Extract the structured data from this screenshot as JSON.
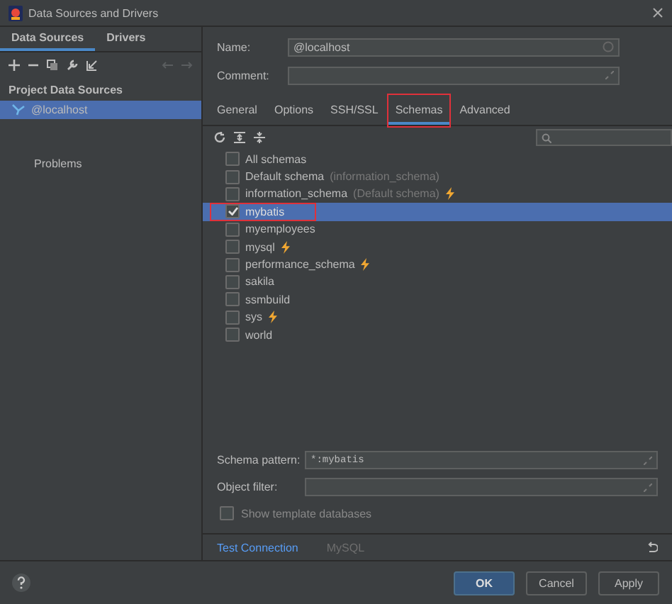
{
  "window": {
    "title": "Data Sources and Drivers"
  },
  "sidebar": {
    "tabs": [
      {
        "label": "Data Sources",
        "selected": true
      },
      {
        "label": "Drivers",
        "selected": false
      }
    ],
    "section": "Project Data Sources",
    "items": [
      {
        "label": "@localhost",
        "selected": true
      }
    ],
    "problems": "Problems"
  },
  "form": {
    "name": {
      "label": "Name:",
      "value": "@localhost"
    },
    "comment": {
      "label": "Comment:"
    }
  },
  "tabs": [
    {
      "label": "General",
      "selected": false,
      "marked": false
    },
    {
      "label": "Options",
      "selected": false,
      "marked": false
    },
    {
      "label": "SSH/SSL",
      "selected": false,
      "marked": false
    },
    {
      "label": "Schemas",
      "selected": true,
      "marked": true
    },
    {
      "label": "Advanced",
      "selected": false,
      "marked": false
    }
  ],
  "schemas": [
    {
      "name": "All schemas",
      "checked": false,
      "selected": false,
      "bolt": false,
      "marked": false
    },
    {
      "name": "Default schema",
      "note": "(information_schema)",
      "checked": false,
      "selected": false,
      "bolt": false,
      "marked": false
    },
    {
      "name": "information_schema",
      "note": "(Default schema)",
      "checked": false,
      "selected": false,
      "bolt": true,
      "marked": false
    },
    {
      "name": "mybatis",
      "checked": true,
      "selected": true,
      "bolt": false,
      "marked": true
    },
    {
      "name": "myemployees",
      "checked": false,
      "selected": false,
      "bolt": false,
      "marked": false
    },
    {
      "name": "mysql",
      "checked": false,
      "selected": false,
      "bolt": true,
      "marked": false
    },
    {
      "name": "performance_schema",
      "checked": false,
      "selected": false,
      "bolt": true,
      "marked": false
    },
    {
      "name": "sakila",
      "checked": false,
      "selected": false,
      "bolt": false,
      "marked": false
    },
    {
      "name": "ssmbuild",
      "checked": false,
      "selected": false,
      "bolt": false,
      "marked": false
    },
    {
      "name": "sys",
      "checked": false,
      "selected": false,
      "bolt": true,
      "marked": false
    },
    {
      "name": "world",
      "checked": false,
      "selected": false,
      "bolt": false,
      "marked": false
    }
  ],
  "pattern": {
    "label": "Schema pattern:",
    "value": "*:mybatis"
  },
  "filter": {
    "label": "Object filter:"
  },
  "show_template": {
    "label": "Show template databases",
    "checked": false
  },
  "links": {
    "test": "Test Connection",
    "driver": "MySQL"
  },
  "buttons": [
    {
      "label": "OK",
      "kind": "primary"
    },
    {
      "label": "Cancel",
      "kind": "normal"
    },
    {
      "label": "Apply",
      "kind": "normal"
    }
  ]
}
